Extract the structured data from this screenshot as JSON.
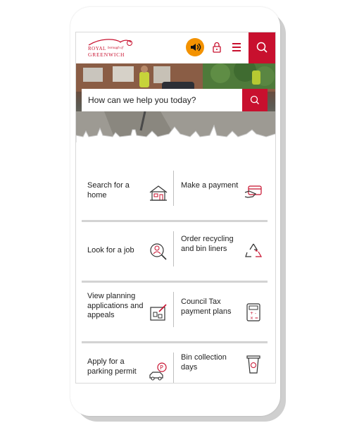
{
  "header": {
    "logo": {
      "royal": "ROYAL",
      "borough": "borough of",
      "name": "GREENWICH"
    },
    "icons": [
      "speaker-icon",
      "lock-icon",
      "hamburger-menu-icon",
      "search-icon"
    ]
  },
  "hero": {
    "search_placeholder": "How can we help you today?"
  },
  "tiles": [
    {
      "label": "Search for a home",
      "icon": "house-icon"
    },
    {
      "label": "Make a payment",
      "icon": "card-payment-icon"
    },
    {
      "label": "Look for a job",
      "icon": "person-magnifier-icon"
    },
    {
      "label": "Order recycling and bin liners",
      "icon": "recycling-icon"
    },
    {
      "label": "View planning applications and appeals",
      "icon": "planning-icon"
    },
    {
      "label": "Council Tax payment plans",
      "icon": "calculator-icon"
    },
    {
      "label": "Apply for a parking permit",
      "icon": "car-parking-icon"
    },
    {
      "label": "Bin collection days",
      "icon": "bin-icon"
    }
  ],
  "colors": {
    "brand": "#c8102e",
    "accent": "#f39200"
  }
}
